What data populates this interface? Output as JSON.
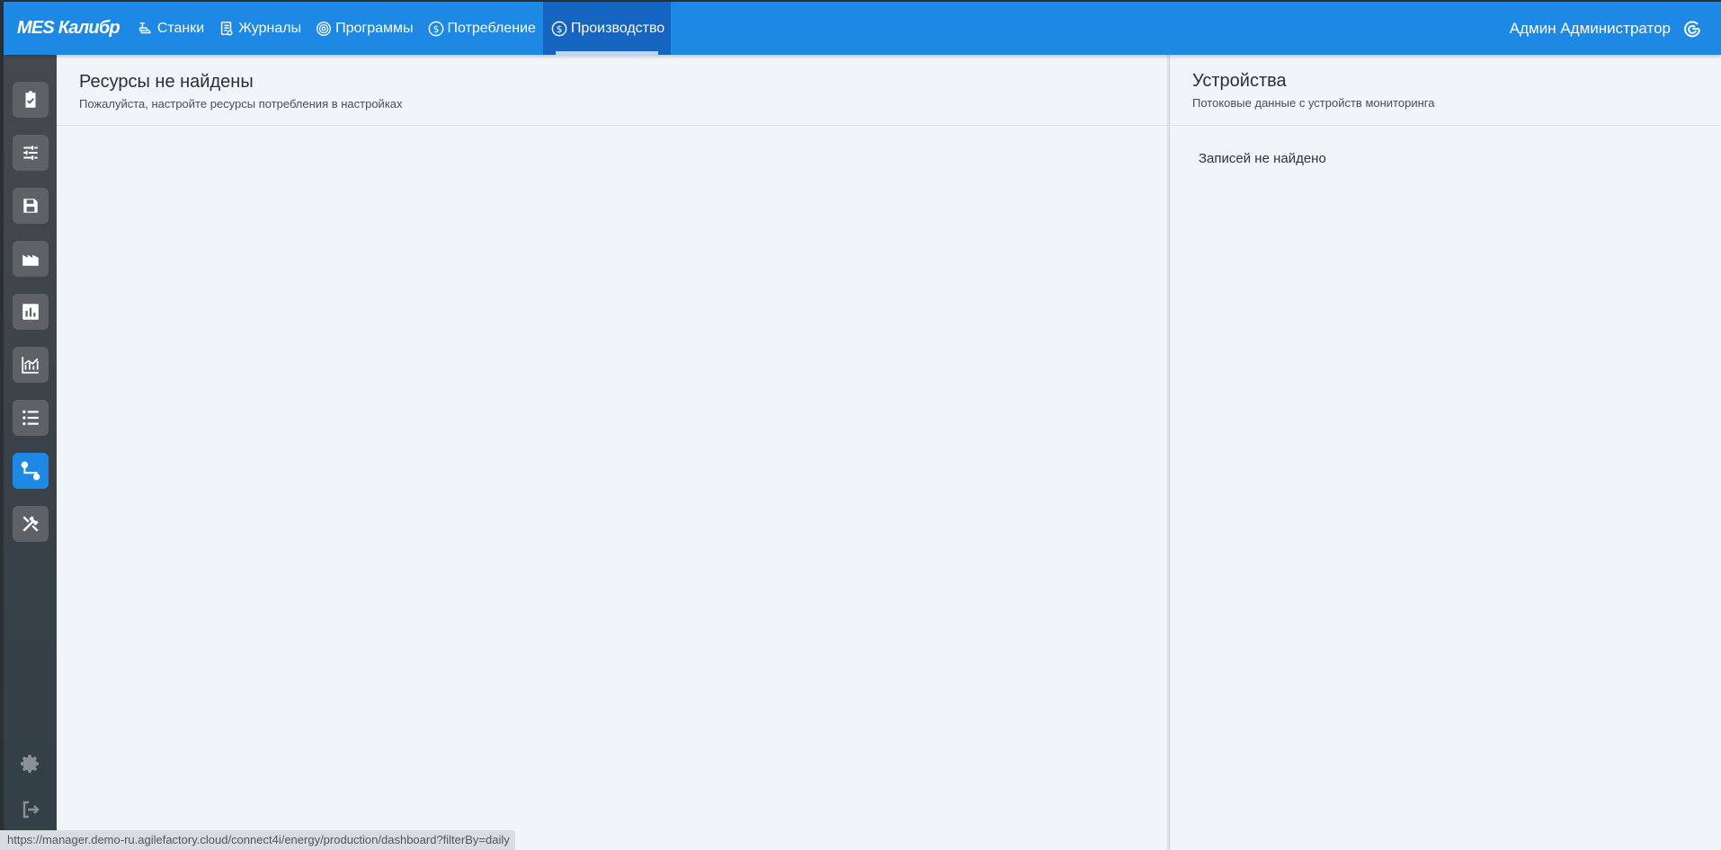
{
  "app": {
    "brand": "MES Калибр"
  },
  "nav": {
    "items": [
      {
        "label": "Станки",
        "icon": "machine-icon"
      },
      {
        "label": "Журналы",
        "icon": "journal-icon"
      },
      {
        "label": "Программы",
        "icon": "target-icon"
      },
      {
        "label": "Потребление",
        "icon": "dollar-icon"
      },
      {
        "label": "Производство",
        "icon": "dollar-icon",
        "active": true
      }
    ]
  },
  "user": {
    "name": "Админ Администратор",
    "icon": "logout-swirl-icon"
  },
  "sidebar": {
    "items": [
      {
        "icon": "clipboard-check-icon"
      },
      {
        "icon": "sliders-icon"
      },
      {
        "icon": "save-icon"
      },
      {
        "icon": "factory-icon"
      },
      {
        "icon": "bar-chart-icon"
      },
      {
        "icon": "line-chart-icon"
      },
      {
        "icon": "list-icon"
      },
      {
        "icon": "workflow-icon",
        "active": true
      },
      {
        "icon": "tools-icon"
      }
    ],
    "bottom": [
      {
        "icon": "gear-icon"
      },
      {
        "icon": "sign-out-icon"
      }
    ]
  },
  "left_panel": {
    "title": "Ресурсы не найдены",
    "subtitle": "Пожалуйста, настройте ресурсы потребления в настройках"
  },
  "right_panel": {
    "title": "Устройства",
    "subtitle": "Потоковые данные с устройств мониторинга",
    "empty": "Записей не найдено"
  },
  "status_url": "https://manager.demo-ru.agilefactory.cloud/connect4i/energy/production/dashboard?filterBy=daily",
  "colors": {
    "primary": "#1e88e5",
    "primary_dark": "#1565c0",
    "sidebar": "#384148",
    "background": "#f1f5f8"
  }
}
